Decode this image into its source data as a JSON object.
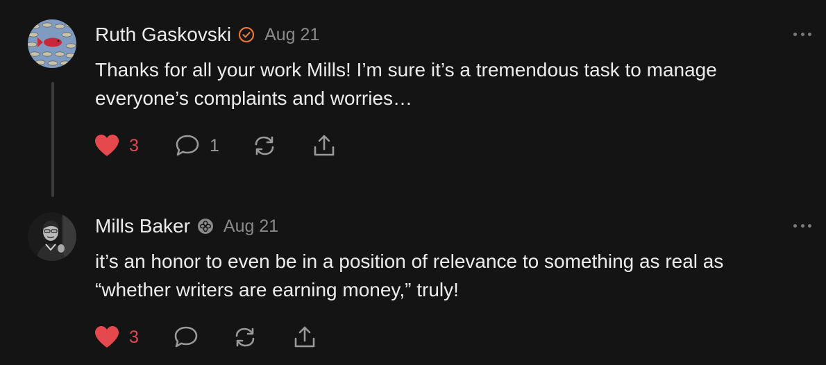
{
  "colors": {
    "background": "#141414",
    "text_primary": "#ececec",
    "text_secondary": "#8a8a8a",
    "like_red": "#e5484d",
    "verified_orange": "#e8762b",
    "icon_gray": "#9a9a9a"
  },
  "comments": [
    {
      "author": "Ruth Gaskovski",
      "badge_icon": "verified-check-icon",
      "date": "Aug 21",
      "text": "Thanks for all your work Mills! I’m sure it’s a tremendous task to manage everyone’s complaints and worries…",
      "likes": "3",
      "replies": "1",
      "liked": true
    },
    {
      "author": "Mills Baker",
      "badge_icon": "staff-flower-icon",
      "date": "Aug 21",
      "text": "it’s an honor to even be in a position of relevance to something as real as “whether writers are earning money,” truly!",
      "likes": "3",
      "replies": "",
      "liked": true
    }
  ]
}
